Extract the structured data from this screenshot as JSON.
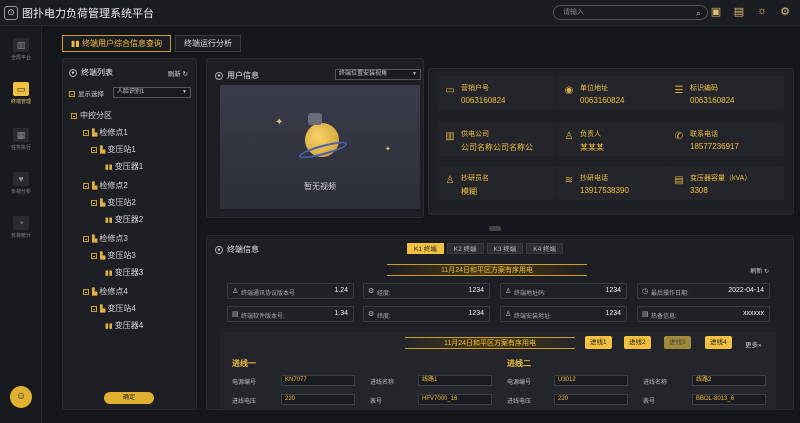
{
  "app": {
    "logo_glyph": "⊙",
    "title": "图扑电力负荷管理系统平台"
  },
  "search": {
    "placeholder": "请输入",
    "icon": "search-icon"
  },
  "top_icons": [
    "image-icon",
    "wallet-icon",
    "bulb-icon",
    "gear-icon"
  ],
  "sidebar": {
    "items": [
      {
        "label": "全局平台",
        "icon": "bar-chart-icon"
      },
      {
        "label": "终端管理",
        "icon": "monitor-icon",
        "active": true
      },
      {
        "label": "任务执行",
        "icon": "screen-icon"
      },
      {
        "label": "负荷分析",
        "icon": "heart-icon"
      },
      {
        "label": "负荷统计",
        "icon": "pie-chart-icon"
      }
    ]
  },
  "tabs": [
    "终端用户综合信息查询",
    "终端运行分析"
  ],
  "terminal_list": {
    "title": "终端列表",
    "refresh_label": "刷新",
    "show_select_label": "显示选择",
    "show_select_value": "人脸识别1",
    "tree": [
      {
        "label": "中控分区",
        "level": 0
      },
      {
        "label": "检修点1",
        "level": 1
      },
      {
        "label": "变压站1",
        "level": 2
      },
      {
        "label": "变压器1",
        "level": 3
      },
      {
        "label": "检修点2",
        "level": 1
      },
      {
        "label": "变压站2",
        "level": 2
      },
      {
        "label": "变压器2",
        "level": 3
      },
      {
        "label": "检修点3",
        "level": 1
      },
      {
        "label": "变压站3",
        "level": 2
      },
      {
        "label": "变压器3",
        "level": 3
      },
      {
        "label": "检修点4",
        "level": 1
      },
      {
        "label": "变压站4",
        "level": 2
      },
      {
        "label": "变压器4",
        "level": 3
      }
    ],
    "bottom_button": "确定"
  },
  "user_info": {
    "title": "用户信息",
    "select_value": "终端位置安装视角",
    "video_placeholder": "暂无视频",
    "cards": [
      {
        "label": "营销户号",
        "value": "0063160824",
        "icon": "monitor-icon"
      },
      {
        "label": "单位地址",
        "value": "0063160824",
        "icon": "location-icon"
      },
      {
        "label": "标识编码",
        "value": "0063160824",
        "icon": "list-icon"
      },
      {
        "label": "供电公司",
        "value": "公司名称公司名称公",
        "icon": "building-icon"
      },
      {
        "label": "负责人",
        "value": "某某某",
        "icon": "user-icon"
      },
      {
        "label": "联系电话",
        "value": "18577236917",
        "icon": "phone-icon"
      },
      {
        "label": "抄研员名",
        "value": "模糊",
        "icon": "person-icon"
      },
      {
        "label": "抄研电话",
        "value": "13917538390",
        "icon": "layers-icon"
      },
      {
        "label": "变压器容量（kVA）",
        "value": "3308",
        "icon": "transformer-icon"
      }
    ]
  },
  "terminal_info": {
    "title": "终端信息",
    "k_tabs": [
      "K1 终端",
      "K2 终端",
      "K3 终端",
      "K4 终端"
    ],
    "banner": "11月24日和平区方案有序用电",
    "refresh_label": "刷新",
    "stats": [
      {
        "label": "终端通讯协议版本号",
        "value": "1.24",
        "icon": "user-icon"
      },
      {
        "label": "经度:",
        "value": "1234",
        "icon": "gear-icon"
      },
      {
        "label": "终端地址码:",
        "value": "1234",
        "icon": "user-icon"
      },
      {
        "label": "最后操作日期:",
        "value": "2022-04-14",
        "icon": "clock-icon"
      },
      {
        "label": "终端软件版本号:",
        "value": "1.34",
        "icon": "doc-icon"
      },
      {
        "label": "纬度:",
        "value": "1234",
        "icon": "gear-icon"
      },
      {
        "label": "终端安装地址:",
        "value": "1234",
        "icon": "user-icon"
      },
      {
        "label": "热备信息:",
        "value": "xxxxxx",
        "icon": "doc-icon"
      }
    ],
    "lower_banner": "11月24日和平区方案有序用电",
    "line_tabs": [
      "进线1",
      "进线2",
      "进线3",
      "进线4"
    ],
    "more_label": "更多",
    "lines": [
      {
        "title": "进线一",
        "rows": [
          {
            "label": "电源编号",
            "value": "KN7077",
            "label2": "进线名称",
            "value2": "线路1"
          },
          {
            "label": "进线电压",
            "value": "220",
            "label2": "表号",
            "value2": "HFV7000_16"
          }
        ]
      },
      {
        "title": "进线二",
        "rows": [
          {
            "label": "电源编号",
            "value": "U3012",
            "label2": "进线名称",
            "value2": "线路2"
          },
          {
            "label": "进线电压",
            "value": "220",
            "label2": "表号",
            "value2": "BBOL-8013_6"
          }
        ]
      }
    ]
  }
}
